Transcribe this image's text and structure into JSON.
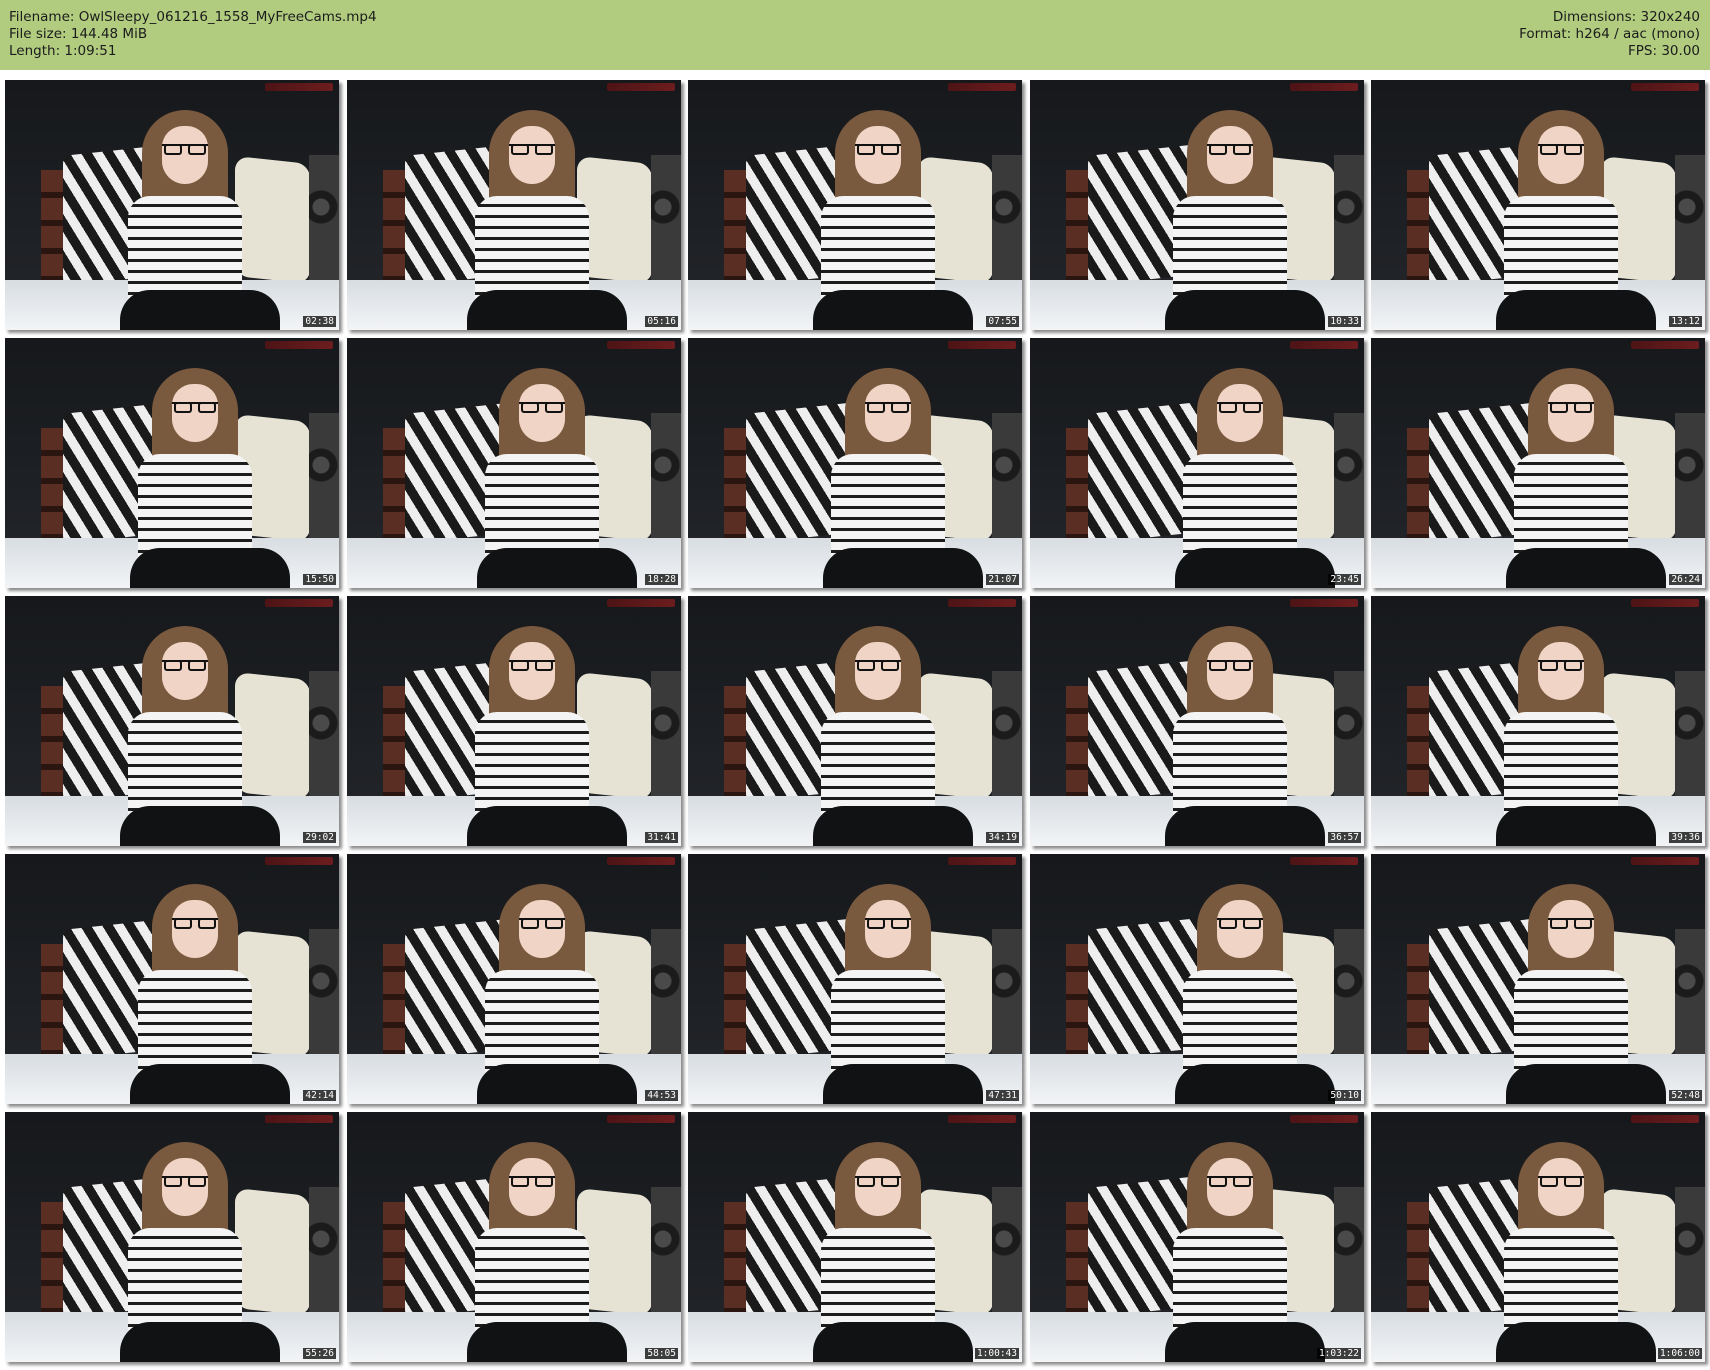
{
  "header": {
    "filename_line": "Filename: OwlSleepy_061216_1558_MyFreeCams.mp4",
    "filesize_line": "File size: 144.48 MiB",
    "length_line": "Length: 1:09:51",
    "dimensions_line": "Dimensions: 320x240",
    "format_line": "Format: h264 / aac (mono)",
    "fps_line": "FPS: 30.00",
    "background_color": "#b1cc7f"
  },
  "thumbnails": [
    {
      "timestamp": "02:38"
    },
    {
      "timestamp": "05:16"
    },
    {
      "timestamp": "07:55"
    },
    {
      "timestamp": "10:33"
    },
    {
      "timestamp": "13:12"
    },
    {
      "timestamp": "15:50"
    },
    {
      "timestamp": "18:28"
    },
    {
      "timestamp": "21:07"
    },
    {
      "timestamp": "23:45"
    },
    {
      "timestamp": "26:24"
    },
    {
      "timestamp": "29:02"
    },
    {
      "timestamp": "31:41"
    },
    {
      "timestamp": "34:19"
    },
    {
      "timestamp": "36:57"
    },
    {
      "timestamp": "39:36"
    },
    {
      "timestamp": "42:14"
    },
    {
      "timestamp": "44:53"
    },
    {
      "timestamp": "47:31"
    },
    {
      "timestamp": "50:10"
    },
    {
      "timestamp": "52:48"
    },
    {
      "timestamp": "55:26"
    },
    {
      "timestamp": "58:05"
    },
    {
      "timestamp": "1:00:43"
    },
    {
      "timestamp": "1:03:22"
    },
    {
      "timestamp": "1:06:00"
    }
  ]
}
